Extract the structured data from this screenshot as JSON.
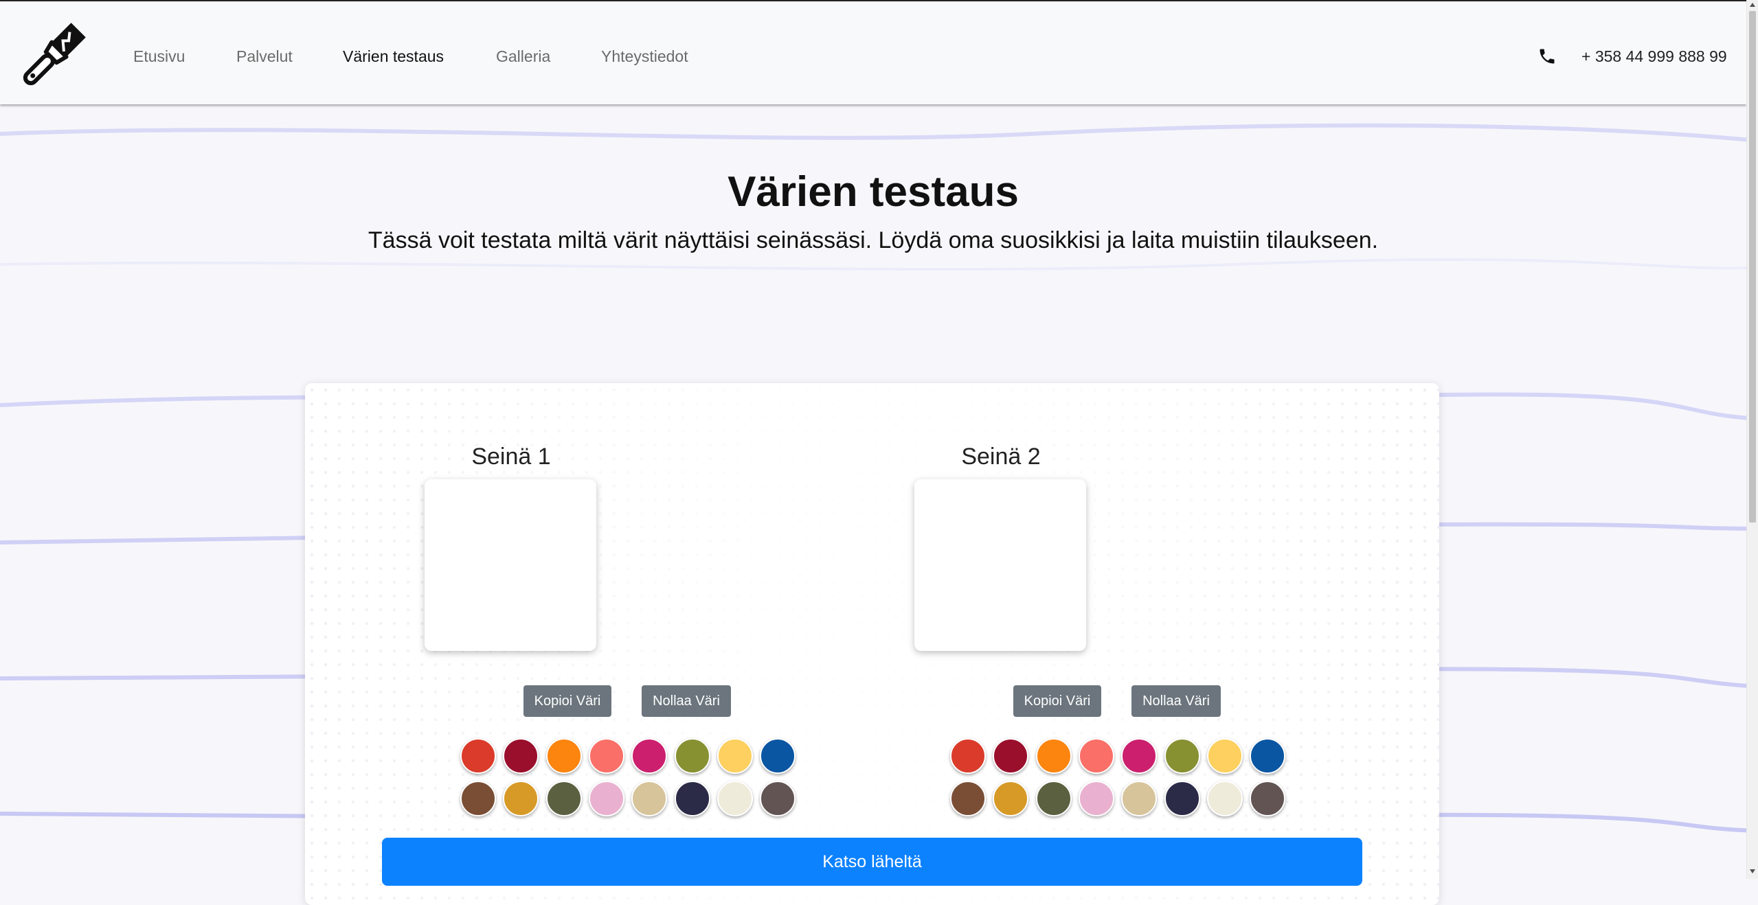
{
  "nav": {
    "links": [
      {
        "label": "Etusivu",
        "active": false
      },
      {
        "label": "Palvelut",
        "active": false
      },
      {
        "label": "Värien testaus",
        "active": true
      },
      {
        "label": "Galleria",
        "active": false
      },
      {
        "label": "Yhteystiedot",
        "active": false
      }
    ],
    "phone": "+ 358 44 999 888 99",
    "logo_icon": "paintbrush-icon",
    "phone_icon": "phone-icon"
  },
  "header": {
    "title": "Värien testaus",
    "subtitle": "Tässä voit testata miltä värit näyttäisi seinässäsi. Löydä oma suosikkisi ja laita muistiin tilaukseen."
  },
  "walls": [
    {
      "title": "Seinä 1",
      "copy_label": "Kopioi Väri",
      "reset_label": "Nollaa Väri",
      "current_color": "#ffffff"
    },
    {
      "title": "Seinä 2",
      "copy_label": "Kopioi Väri",
      "reset_label": "Nollaa Väri",
      "current_color": "#ffffff"
    }
  ],
  "palette": [
    [
      "#db3b2a",
      "#9a0f2c",
      "#fb850f",
      "#fa6f68",
      "#cc1f6e",
      "#879132",
      "#fdd05f",
      "#0a56a2"
    ],
    [
      "#7a4e35",
      "#d79a27",
      "#5b6040",
      "#e9b1cf",
      "#d7c49b",
      "#2b2a47",
      "#efebdb",
      "#615453"
    ]
  ],
  "view_button": "Katso läheltä",
  "colors": {
    "primary": "#0d82ff",
    "secondary": "#6c757d",
    "wave": "#cfcff5"
  }
}
